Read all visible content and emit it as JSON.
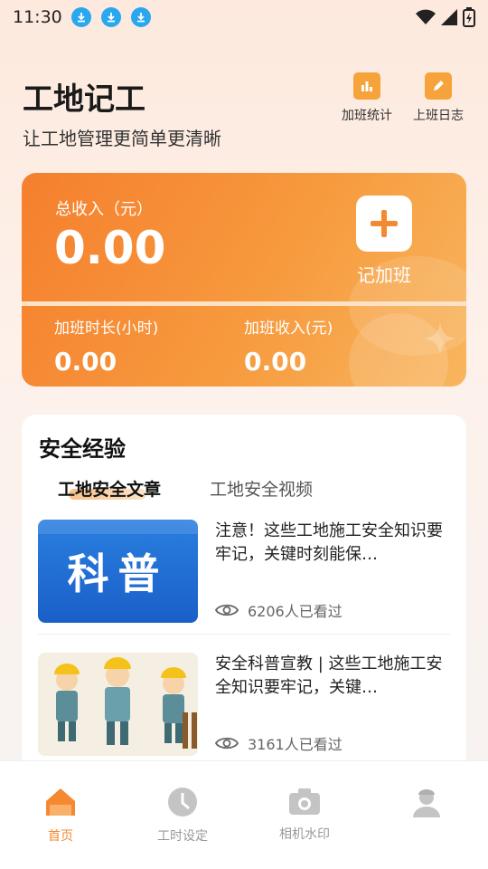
{
  "status_bar": {
    "time": "11:30"
  },
  "header": {
    "title": "工地记工",
    "subtitle": "让工地管理更简单更清晰",
    "actions": [
      {
        "label": "加班统计",
        "icon": "chart-calendar-icon"
      },
      {
        "label": "上班日志",
        "icon": "edit-calendar-icon"
      }
    ]
  },
  "income_card": {
    "total_label": "总收入（元）",
    "total_value": "0.00",
    "add_label": "记加班",
    "stats": [
      {
        "label": "加班时长(小时)",
        "value": "0.00"
      },
      {
        "label": "加班收入(元)",
        "value": "0.00"
      }
    ]
  },
  "safety": {
    "title": "安全经验",
    "tabs": [
      {
        "label": "工地安全文章",
        "active": true
      },
      {
        "label": "工地安全视频",
        "active": false
      }
    ],
    "articles": [
      {
        "thumb_text": "科普",
        "title": "注意！这些工地施工安全知识要牢记，关键时刻能保…",
        "views": "6206人已看过"
      },
      {
        "title": "安全科普宣教 | 这些工地施工安全知识要牢记，关键…",
        "views": "3161人已看过"
      }
    ]
  },
  "bottom_nav": [
    {
      "label": "首页",
      "icon": "home-icon",
      "active": true
    },
    {
      "label": "工时设定",
      "icon": "clock-icon",
      "active": false
    },
    {
      "label": "相机水印",
      "icon": "camera-icon",
      "active": false
    },
    {
      "label": "",
      "icon": "profile-icon",
      "active": false
    }
  ],
  "colors": {
    "accent": "#f5892f",
    "card_start": "#f57f2e",
    "card_end": "#f8b65e",
    "download_badge": "#29a8f0"
  }
}
